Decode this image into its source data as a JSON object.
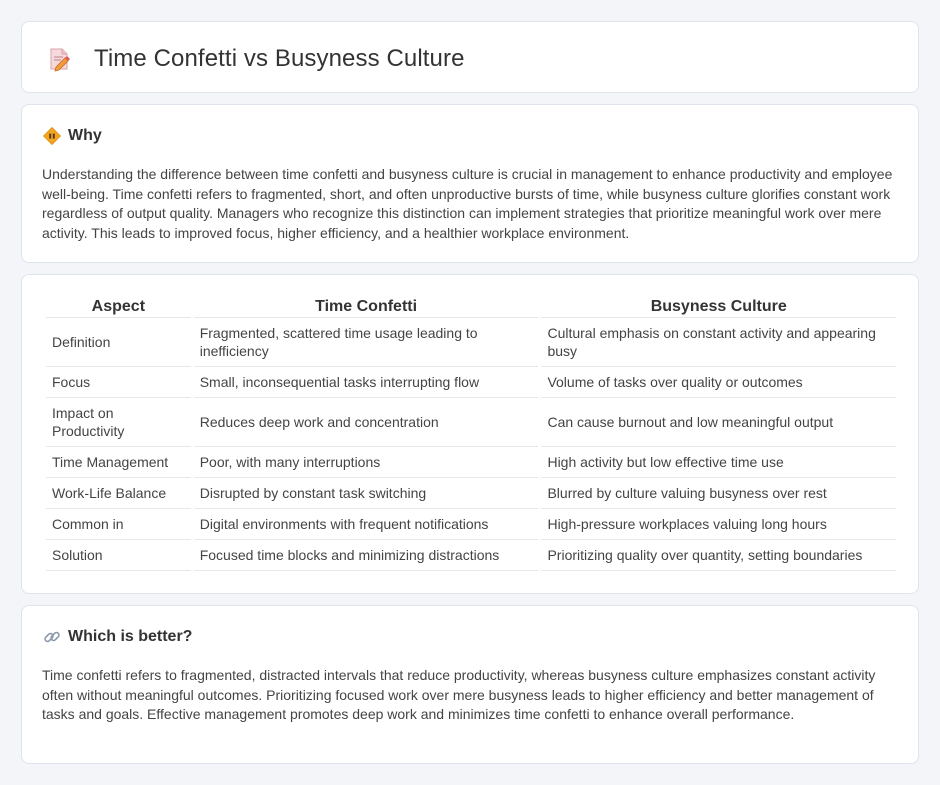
{
  "page": {
    "title": "Time Confetti vs Busyness Culture",
    "title_icon": "document-pencil-icon"
  },
  "why": {
    "icon": "diamond-warning-icon",
    "heading": "Why",
    "text": "Understanding the difference between time confetti and busyness culture is crucial in management to enhance productivity and employee well-being. Time confetti refers to fragmented, short, and often unproductive bursts of time, while busyness culture glorifies constant work regardless of output quality. Managers who recognize this distinction can implement strategies that prioritize meaningful work over mere activity. This leads to improved focus, higher efficiency, and a healthier workplace environment."
  },
  "table": {
    "headers": [
      "Aspect",
      "Time Confetti",
      "Busyness Culture"
    ],
    "rows": [
      [
        "Definition",
        "Fragmented, scattered time usage leading to inefficiency",
        "Cultural emphasis on constant activity and appearing busy"
      ],
      [
        "Focus",
        "Small, inconsequential tasks interrupting flow",
        "Volume of tasks over quality or outcomes"
      ],
      [
        "Impact on Productivity",
        "Reduces deep work and concentration",
        "Can cause burnout and low meaningful output"
      ],
      [
        "Time Management",
        "Poor, with many interruptions",
        "High activity but low effective time use"
      ],
      [
        "Work-Life Balance",
        "Disrupted by constant task switching",
        "Blurred by culture valuing busyness over rest"
      ],
      [
        "Common in",
        "Digital environments with frequent notifications",
        "High-pressure workplaces valuing long hours"
      ],
      [
        "Solution",
        "Focused time blocks and minimizing distractions",
        "Prioritizing quality over quantity, setting boundaries"
      ]
    ]
  },
  "better": {
    "icon": "link-icon",
    "heading": "Which is better?",
    "text": "Time confetti refers to fragmented, distracted intervals that reduce productivity, whereas busyness culture emphasizes constant activity often without meaningful outcomes. Prioritizing focused work over mere busyness leads to higher efficiency and better management of tasks and goals. Effective management promotes deep work and minimizes time confetti to enhance overall performance."
  },
  "colors": {
    "background": "#f3f5f9",
    "card": "#ffffff",
    "border": "#dfe3ec",
    "accent_orange": "#f0a030"
  }
}
